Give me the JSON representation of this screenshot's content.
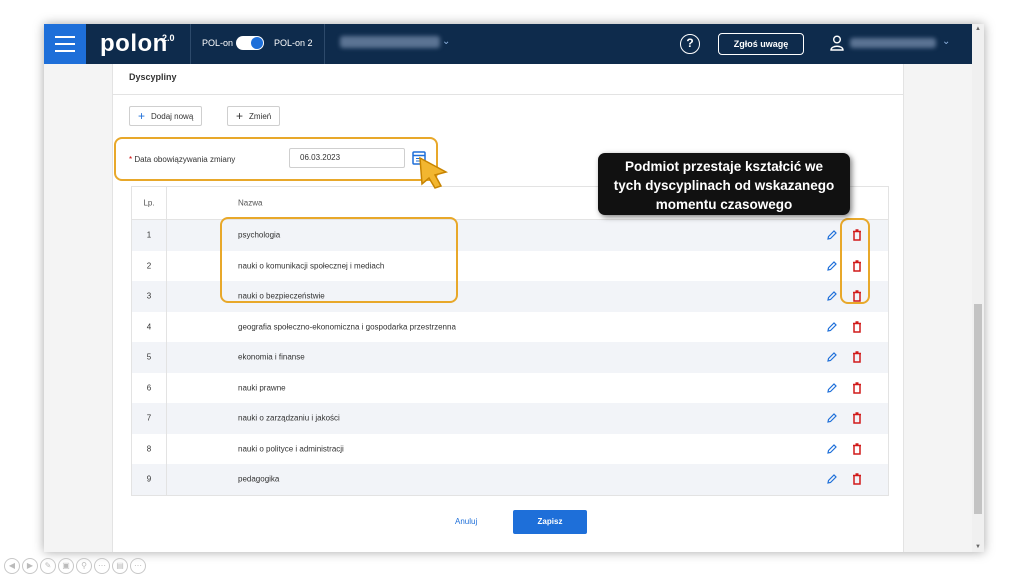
{
  "header": {
    "logo": "polon",
    "logo_sup": "2.0",
    "toggle_left": "POL-on",
    "toggle_right": "POL-on 2",
    "report_button": "Zgłoś uwagę",
    "help": "?"
  },
  "section": {
    "title": "Dyscypliny",
    "add_button": "Dodaj nową",
    "change_button": "Zmień"
  },
  "date_field": {
    "required_mark": "*",
    "label": "Data obowiązywania zmiany",
    "value": "06.03.2023"
  },
  "table": {
    "col_lp": "Lp.",
    "col_name": "Nazwa",
    "rows": [
      {
        "lp": "1",
        "name": "psychologia"
      },
      {
        "lp": "2",
        "name": "nauki o komunikacji społecznej i mediach"
      },
      {
        "lp": "3",
        "name": "nauki o bezpieczeństwie"
      },
      {
        "lp": "4",
        "name": "geografia społeczno-ekonomiczna i gospodarka przestrzenna"
      },
      {
        "lp": "5",
        "name": "ekonomia i finanse"
      },
      {
        "lp": "6",
        "name": "nauki prawne"
      },
      {
        "lp": "7",
        "name": "nauki o zarządzaniu i jakości"
      },
      {
        "lp": "8",
        "name": "nauki o polityce i administracji"
      },
      {
        "lp": "9",
        "name": "pedagogika"
      }
    ]
  },
  "footer": {
    "cancel": "Anuluj",
    "save": "Zapisz"
  },
  "callout": {
    "line1": "Podmiot przestaje kształcić we",
    "line2": "tych dyscyplinach od wskazanego",
    "line3": "momentu czasowego"
  },
  "colors": {
    "nav_bg": "#0e2b4c",
    "accent": "#1e6fd9",
    "highlight": "#e8a82a",
    "delete": "#d11a1a"
  }
}
